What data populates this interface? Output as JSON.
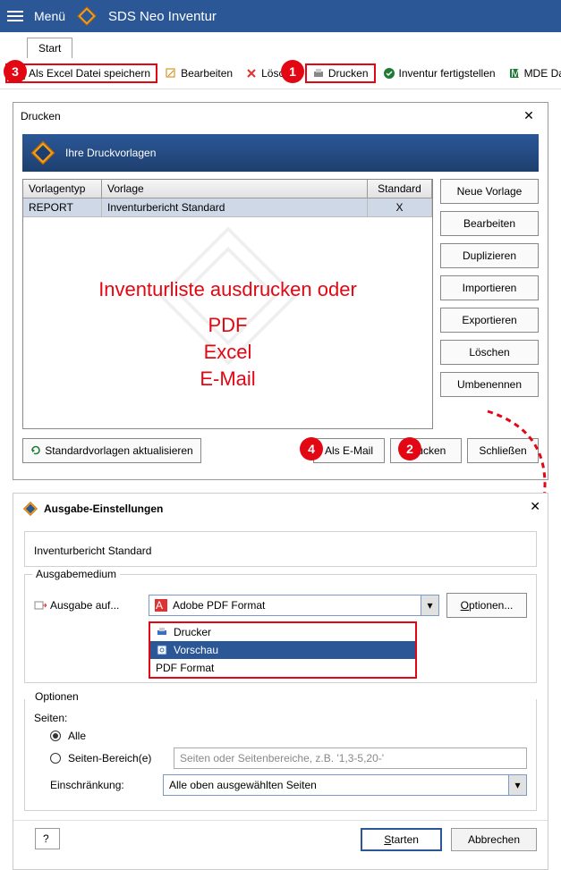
{
  "app": {
    "menu": "Menü",
    "title": "SDS Neo Inventur"
  },
  "tabs": {
    "start": "Start"
  },
  "toolbar": {
    "excel": "Als Excel Datei speichern",
    "edit": "Bearbeiten",
    "delete": "Lösche",
    "print": "Drucken",
    "finish": "Inventur fertigstellen",
    "mde": "MDE Daten ein"
  },
  "dialog1": {
    "title": "Drucken",
    "header": "Ihre Druckvorlagen",
    "cols": {
      "type": "Vorlagentyp",
      "tmpl": "Vorlage",
      "std": "Standard"
    },
    "row": {
      "type": "REPORT",
      "tmpl": "Inventurbericht Standard",
      "std": "X"
    },
    "side": {
      "neu": "Neue Vorlage",
      "edit": "Bearbeiten",
      "dup": "Duplizieren",
      "imp": "Importieren",
      "exp": "Exportieren",
      "del": "Löschen",
      "ren": "Umbenennen"
    },
    "annot1": "Inventurliste ausdrucken oder",
    "annot2": "PDF",
    "annot3": "Excel",
    "annot4": "E-Mail",
    "foot": {
      "update": "Standardvorlagen aktualisieren",
      "email": "Als E-Mail",
      "print": "Drucken",
      "close": "Schließen"
    }
  },
  "dialog2": {
    "title": "Ausgabe-Einstellungen",
    "subtitle": "Inventurbericht Standard",
    "grp_medium": "Ausgabemedium",
    "out_label": "Ausgabe auf...",
    "out_value": "Adobe PDF Format",
    "opt_btn": "Optionen...",
    "dd": {
      "printer": "Drucker",
      "preview": "Vorschau",
      "pdf": "PDF Format"
    },
    "grp_opt": "Optionen",
    "pages": "Seiten:",
    "all": "Alle",
    "range": "Seiten-Bereich(e)",
    "range_ph": "Seiten oder Seitenbereiche, z.B. '1,3-5,20-'",
    "restrict": "Einschränkung:",
    "restrict_value": "Alle oben ausgewählten Seiten",
    "start": "Starten",
    "cancel": "Abbrechen"
  },
  "badges": {
    "b1": "1",
    "b2": "2",
    "b3": "3",
    "b4": "4"
  }
}
